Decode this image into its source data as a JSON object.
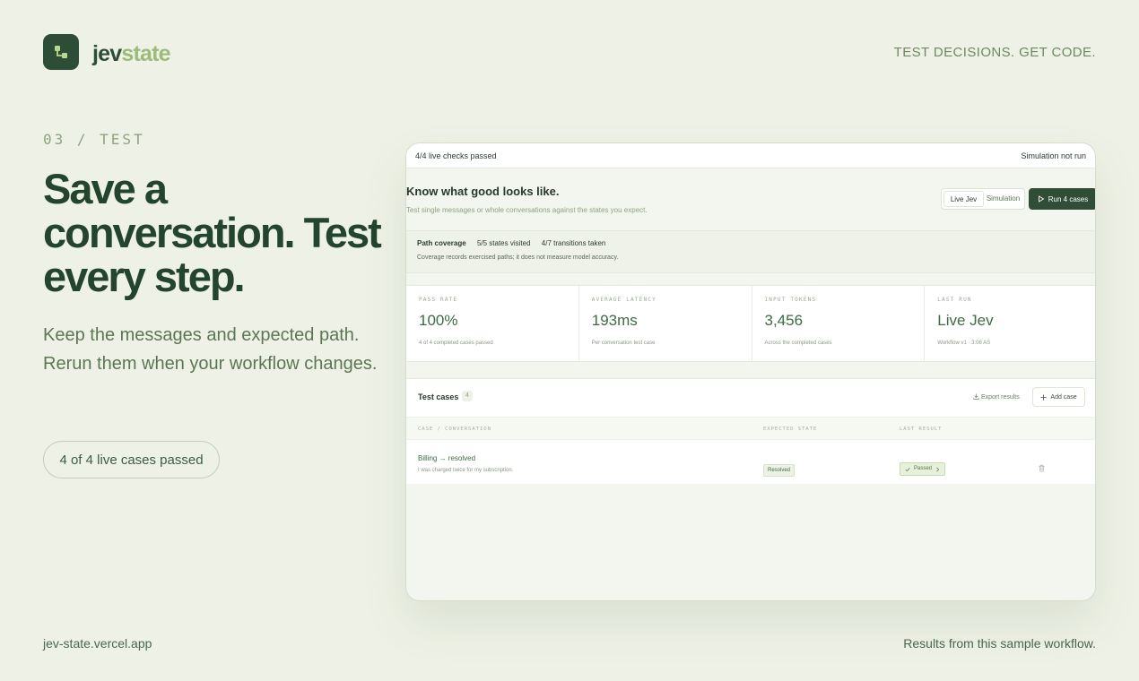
{
  "brand": {
    "part1": "jev",
    "part2": "state"
  },
  "tagline": "TEST DECISIONS. GET CODE.",
  "hero": {
    "eyebrow": "03 / TEST",
    "headline": "Save a conversation. Test every step.",
    "subtitle": "Keep the messages and expected path. Rerun them when your workflow changes.",
    "pill": "4 of 4 live cases passed"
  },
  "footer": {
    "left": "jev-state.vercel.app",
    "right": "Results from this sample workflow."
  },
  "app": {
    "topbar": {
      "left": "4/4 live checks passed",
      "right": "Simulation not run"
    },
    "section": {
      "title": "Know what good looks like.",
      "subtitle": "Test single messages or whole conversations against the states you expect."
    },
    "mode_toggle": {
      "options": [
        "Live Jev",
        "Simulation"
      ],
      "selected": "Live Jev"
    },
    "run_button": "Run 4 cases",
    "coverage": {
      "label": "Path coverage",
      "states": "5/5 states visited",
      "transitions": "4/7 transitions taken",
      "note": "Coverage records exercised paths; it does not measure model accuracy."
    },
    "stats": [
      {
        "label": "PASS RATE",
        "value": "100%",
        "caption": "4 of 4 completed cases passed"
      },
      {
        "label": "AVERAGE LATENCY",
        "value": "193ms",
        "caption": "Per conversation test case"
      },
      {
        "label": "INPUT TOKENS",
        "value": "3,456",
        "caption": "Across the completed cases"
      },
      {
        "label": "LAST RUN",
        "value": "Live Jev",
        "caption": "Workflow v1 · 3:06 AS"
      }
    ],
    "cases": {
      "title": "Test cases",
      "count": "4",
      "export_label": "Export results",
      "add_label": "Add case",
      "columns": [
        "CASE / CONVERSATION",
        "EXPECTED STATE",
        "LAST RESULT"
      ],
      "rows": [
        {
          "name": "Billing → resolved",
          "description": "I was charged twice for my subscription.",
          "expected": "Resolved",
          "result": "Passed"
        }
      ]
    }
  },
  "colors": {
    "background": "#eef2e6",
    "primary": "#2d4d36",
    "accent": "#9cbb7b",
    "success": "#4a7a45"
  },
  "icons": [
    "workflow-logo-icon",
    "play-icon",
    "download-icon",
    "plus-icon",
    "check-icon",
    "chevron-right-icon",
    "trash-icon"
  ]
}
